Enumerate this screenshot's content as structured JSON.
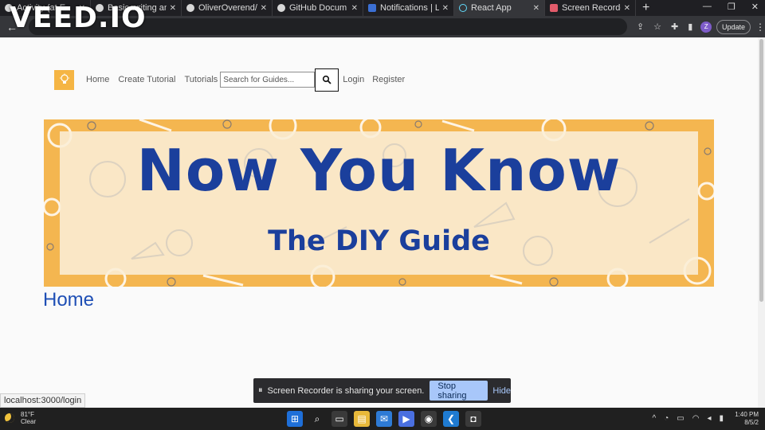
{
  "overlay": {
    "watermark": "VEED.IO"
  },
  "browser": {
    "tabs": [
      {
        "label": "Activity (at E",
        "icon": "generic-tab-icon"
      },
      {
        "label": "Basic writing an",
        "icon": "github-icon"
      },
      {
        "label": "OliverOverend/",
        "icon": "github-icon"
      },
      {
        "label": "GitHub Docum",
        "icon": "github-icon"
      },
      {
        "label": "Notifications | L",
        "icon": "linkedin-icon"
      },
      {
        "label": "React App",
        "icon": "react-icon",
        "active": true
      },
      {
        "label": "Screen Recorde",
        "icon": "recorder-icon"
      }
    ],
    "new_tab": "+",
    "update_label": "Update",
    "profile_initial": "Z"
  },
  "site": {
    "nav": {
      "links": [
        "Home",
        "Create Tutorial",
        "Tutorials"
      ],
      "search_placeholder": "Search for Guides...",
      "login": "Login",
      "register": "Register"
    },
    "banner": {
      "title": "Now You Know",
      "subtitle": "The DIY Guide",
      "colors": {
        "frame": "#f4b650",
        "text": "#1b3f9c"
      }
    },
    "heading": "Home"
  },
  "screen_share": {
    "message": "Screen Recorder is sharing your screen.",
    "stop_label": "Stop sharing",
    "hide_label": "Hide"
  },
  "status_url": "localhost:3000/login",
  "taskbar": {
    "weather_temp": "81°F",
    "weather_desc": "Clear",
    "time": "1:40 PM",
    "date": "8/5/2"
  }
}
